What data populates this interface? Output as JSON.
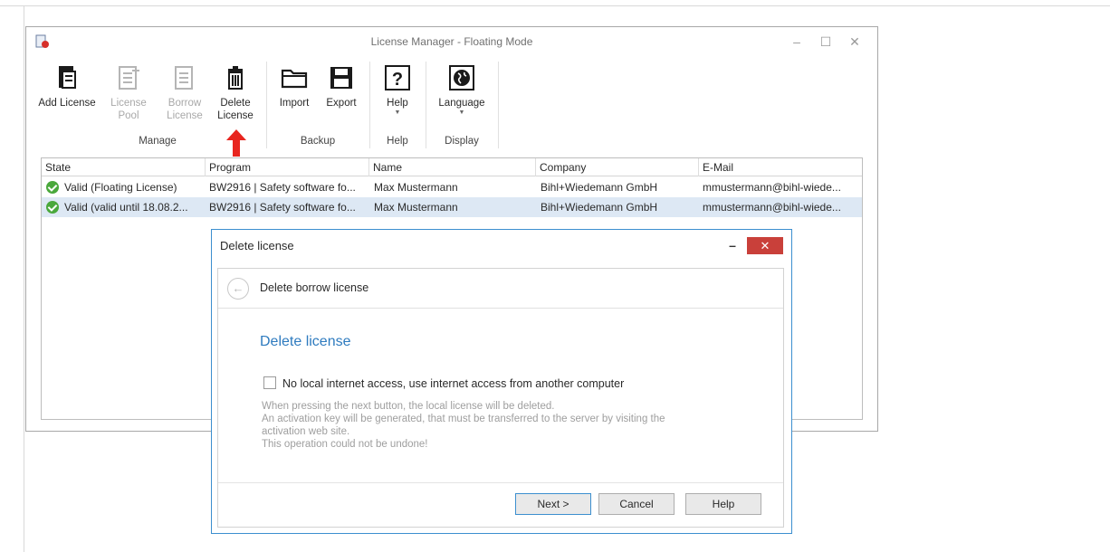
{
  "window": {
    "title": "License Manager - Floating Mode",
    "controls": {
      "minimize": "–",
      "maximize": "☐",
      "close": "✕"
    }
  },
  "ribbon": {
    "buttons": {
      "add_license": "Add License",
      "license_pool": "License Pool",
      "borrow_license": "Borrow License",
      "delete_license": "Delete License",
      "import": "Import",
      "export": "Export",
      "help": "Help",
      "language": "Language"
    },
    "groups": {
      "manage": "Manage",
      "backup": "Backup",
      "help": "Help",
      "display": "Display"
    }
  },
  "table": {
    "columns": [
      "State",
      "Program",
      "Name",
      "Company",
      "E-Mail"
    ],
    "rows": [
      {
        "state": "Valid (Floating License)",
        "program": "BW2916 | Safety software fo...",
        "name": "Max Mustermann",
        "company": "Bihl+Wiedemann GmbH",
        "email": "mmustermann@bihl-wiede...",
        "selected": false
      },
      {
        "state": "Valid (valid until 18.08.2...",
        "program": "BW2916 | Safety software fo...",
        "name": "Max Mustermann",
        "company": "Bihl+Wiedemann GmbH",
        "email": "mmustermann@bihl-wiede...",
        "selected": true
      }
    ]
  },
  "dialog": {
    "title": "Delete license",
    "min_label": "–",
    "close_label": "✕",
    "back_label": "←",
    "wizard_step": "Delete borrow license",
    "heading": "Delete license",
    "checkbox_label": "No local internet access, use internet access from another computer",
    "checkbox_checked": false,
    "info_lines": [
      "When pressing the next button, the local license will be deleted.",
      "An activation key will be generated, that must be transferred to the server by visiting the",
      "activation web site.",
      "This operation could not be undone!"
    ],
    "buttons": {
      "next": "Next >",
      "cancel": "Cancel",
      "help": "Help"
    }
  },
  "colors": {
    "accent": "#2e7bbf",
    "dialog_border": "#3c8fcf",
    "close_red": "#c9403a",
    "valid_green": "#4aa83c",
    "selected_row": "#dde8f4",
    "arrow_red": "#e8251f"
  },
  "icons": {
    "app": "license-app-icon",
    "add_license": "add-license-icon",
    "license_pool": "license-pool-icon",
    "borrow_license": "borrow-license-icon",
    "delete_license": "trash-icon",
    "import": "folder-icon",
    "export": "floppy-disk-icon",
    "help": "question-mark-icon",
    "language": "globe-icon",
    "state": "check-circle-icon"
  }
}
